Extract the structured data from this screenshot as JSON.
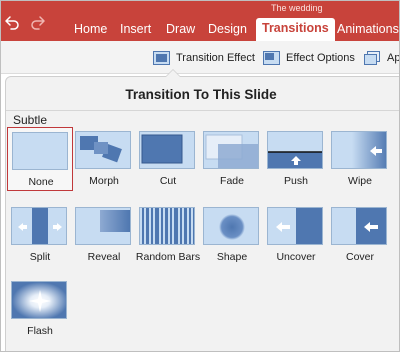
{
  "window": {
    "doc_title": "The wedding"
  },
  "ribbon": {
    "tabs": [
      {
        "label": "Home"
      },
      {
        "label": "Insert"
      },
      {
        "label": "Draw"
      },
      {
        "label": "Design"
      },
      {
        "label": "Transitions",
        "active": true
      },
      {
        "label": "Animations"
      }
    ]
  },
  "toolbar": {
    "transition_effect": "Transition Effect",
    "effect_options": "Effect Options",
    "apply_partial": "Ap"
  },
  "popover": {
    "title": "Transition To This Slide",
    "section": "Subtle",
    "items": [
      {
        "label": "None",
        "icon": "none-thumb",
        "selected": true
      },
      {
        "label": "Morph",
        "icon": "morph-thumb"
      },
      {
        "label": "Cut",
        "icon": "cut-thumb"
      },
      {
        "label": "Fade",
        "icon": "fade-thumb"
      },
      {
        "label": "Push",
        "icon": "push-thumb"
      },
      {
        "label": "Wipe",
        "icon": "wipe-thumb"
      },
      {
        "label": "Split",
        "icon": "split-thumb"
      },
      {
        "label": "Reveal",
        "icon": "reveal-thumb"
      },
      {
        "label": "Random Bars",
        "icon": "random-bars-thumb"
      },
      {
        "label": "Shape",
        "icon": "shape-thumb"
      },
      {
        "label": "Uncover",
        "icon": "uncover-thumb"
      },
      {
        "label": "Cover",
        "icon": "cover-thumb"
      },
      {
        "label": "Flash",
        "icon": "flash-thumb"
      }
    ]
  },
  "colors": {
    "accent": "#c8433b",
    "thumb_bg": "#c7dcf2",
    "thumb_dark": "#4f77b0"
  }
}
